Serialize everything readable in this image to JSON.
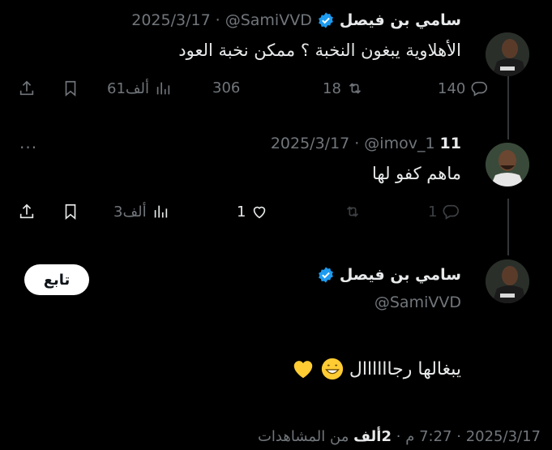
{
  "tweet1": {
    "name": "سامي بن فيصل",
    "handle": "@SamiVVD",
    "date": "2025/3/17",
    "text": "الأهلاوية يبغون النخبة ؟ ممكن نخبة العود",
    "replies": "140",
    "retweets": "18",
    "likes": "306",
    "views": "61ألف"
  },
  "tweet2": {
    "name": "11",
    "handle": "@imov_1",
    "date": "2025/3/17",
    "text": "ماهم كفو لها",
    "replies": "1",
    "likes": "1",
    "views": "3ألف"
  },
  "tweet3": {
    "name": "سامي بن فيصل",
    "handle": "@SamiVVD",
    "follow_label": "تابع",
    "text": "يبغالها رجاااااال",
    "footer_date": "2025/3/17",
    "footer_time": "7:27 م",
    "footer_views_number": "2ألف",
    "footer_views_label": "من المشاهدات",
    "footer_sep": "·"
  },
  "colors": {
    "background": "#000000",
    "text": "#e7e9ea",
    "muted": "#71767b",
    "verified": "#1d9bf0"
  },
  "icons": [
    "reply-icon",
    "retweet-icon",
    "like-icon",
    "views-icon",
    "bookmark-icon",
    "share-icon",
    "verified-icon",
    "more-icon"
  ]
}
